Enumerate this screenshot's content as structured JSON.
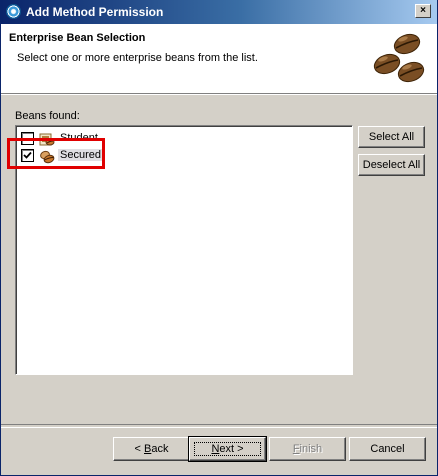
{
  "window": {
    "title": "Add Method Permission",
    "close_glyph": "×"
  },
  "banner": {
    "heading": "Enterprise Bean Selection",
    "description": "Select one or more enterprise beans from the list.",
    "art_icon": "coffee-beans-icon"
  },
  "list": {
    "label": "Beans found:",
    "items": [
      {
        "label": "Student",
        "checked": false,
        "icon": "entity-bean-icon"
      },
      {
        "label": "Secured",
        "checked": true,
        "icon": "session-bean-icon"
      }
    ]
  },
  "side_buttons": {
    "select_all": "Select All",
    "deselect_all": "Deselect All"
  },
  "footer": {
    "back_pre": "< ",
    "back_key": "B",
    "back_post": "ack",
    "next_key": "N",
    "next_post": "ext >",
    "finish_key": "F",
    "finish_post": "inish",
    "cancel": "Cancel"
  },
  "colors": {
    "highlight": "#e00000",
    "titlebar_start": "#0a246a",
    "titlebar_end": "#a6caf0"
  }
}
